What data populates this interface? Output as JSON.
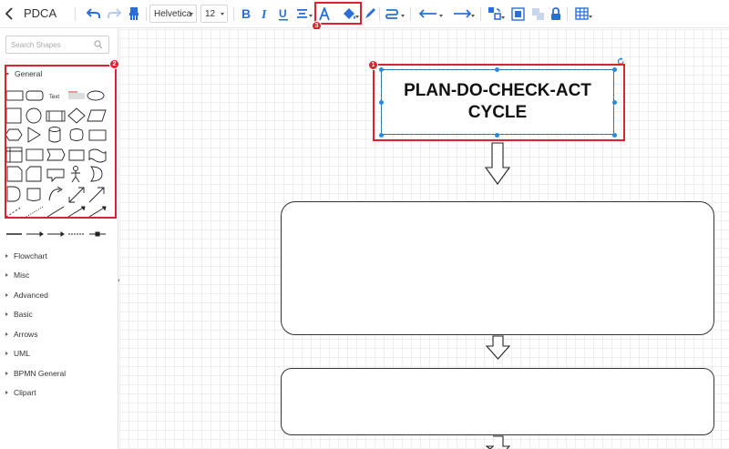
{
  "app": {
    "document_title": "PDCA"
  },
  "toolbar": {
    "font_family": "Helvetica",
    "font_size": "12"
  },
  "sidebar": {
    "search_placeholder": "Search Shapes",
    "sections": [
      {
        "label": "General",
        "expanded": true
      },
      {
        "label": "Flowchart",
        "expanded": false
      },
      {
        "label": "Misc",
        "expanded": false
      },
      {
        "label": "Advanced",
        "expanded": false
      },
      {
        "label": "Basic",
        "expanded": false
      },
      {
        "label": "Arrows",
        "expanded": false
      },
      {
        "label": "UML",
        "expanded": false
      },
      {
        "label": "BPMN General",
        "expanded": false
      },
      {
        "label": "Clipart",
        "expanded": false
      }
    ],
    "general_text_shape_label": "Text",
    "collapse_glyph": "«"
  },
  "canvas": {
    "title_shape_text_line1": "PLAN-DO-CHECK-ACT",
    "title_shape_text_line2": "CYCLE"
  },
  "annotations": {
    "badge_1": "1",
    "badge_2": "2",
    "badge_3": "3"
  },
  "colors": {
    "accent_blue": "#2b6fd6",
    "highlight_red": "#d9232e",
    "selection_blue": "#2b8ad8"
  }
}
